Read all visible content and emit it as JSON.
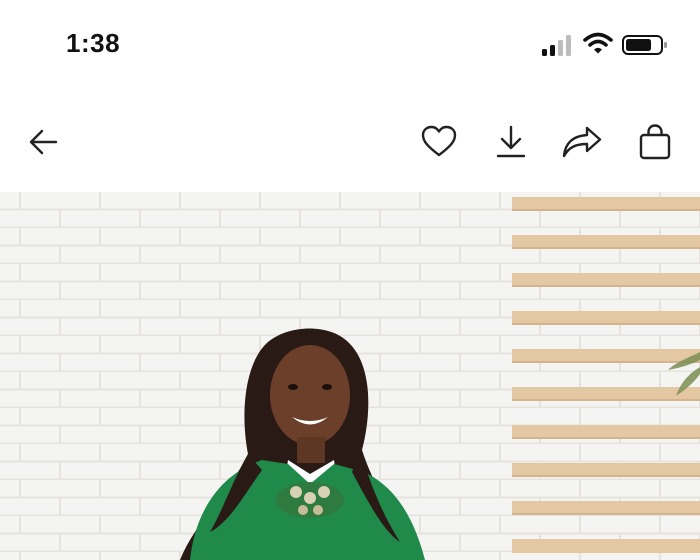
{
  "status_bar": {
    "time": "1:38",
    "icons": [
      "cellular-signal-icon",
      "wifi-icon",
      "battery-icon"
    ]
  },
  "toolbar": {
    "buttons": [
      "back-arrow-icon",
      "heart-icon",
      "download-icon",
      "share-icon",
      "shopping-bag-icon"
    ]
  },
  "photo": {
    "subject": "person-in-green-sweater",
    "colors": {
      "wall": "#f3f2f0",
      "slat": "#e4c8a3",
      "sweater": "#1f8a4a"
    }
  }
}
